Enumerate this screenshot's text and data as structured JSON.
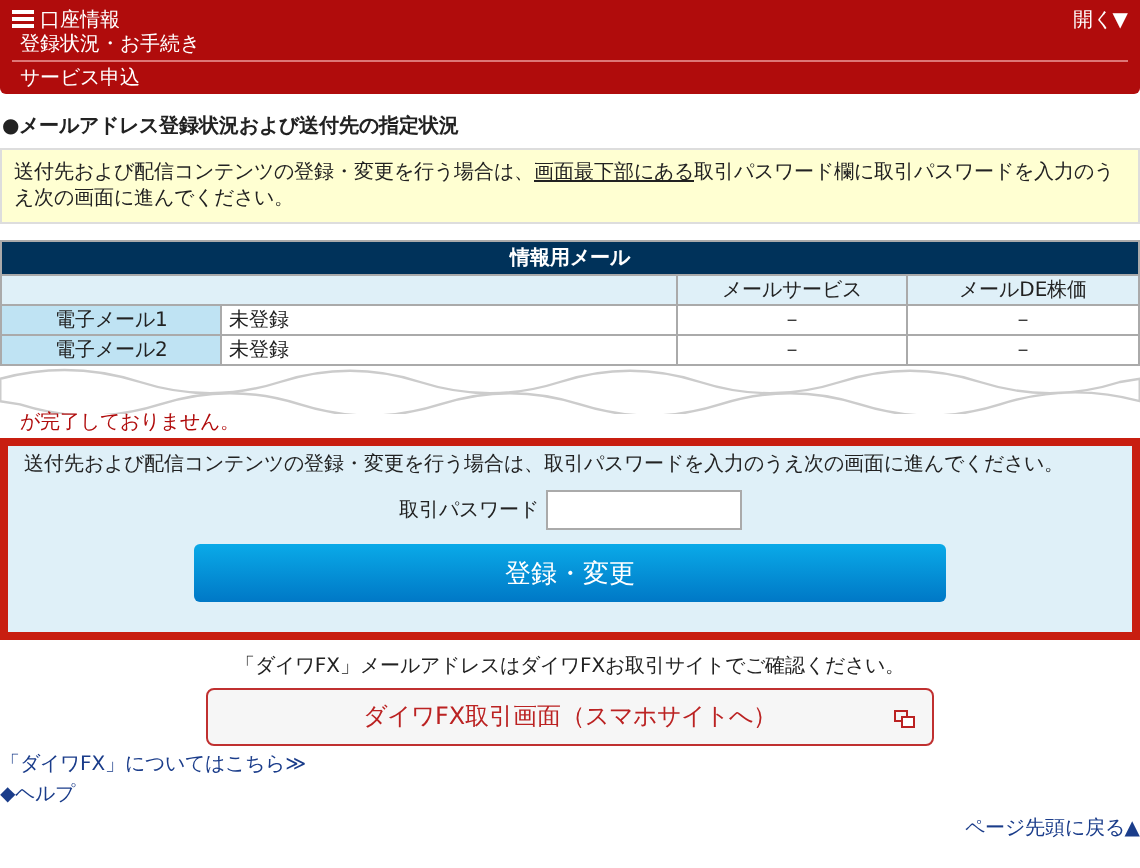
{
  "header": {
    "title": "口座情報",
    "toggle": "開く▼",
    "breadcrumb": "登録状況・お手続き",
    "subtitle": "サービス申込"
  },
  "section_title": "●メールアドレス登録状況および送付先の指定状況",
  "notice": {
    "before": "送付先および配信コンテンツの登録・変更を行う場合は、",
    "link": "画面最下部にある",
    "after": "取引パスワード欄に取引パスワードを入力のうえ次の画面に進んでください。"
  },
  "table": {
    "title": "情報用メール",
    "columns": [
      "メールサービス",
      "メールDE株価"
    ],
    "rows": [
      {
        "label": "電子メール1",
        "status": "未登録",
        "cells": [
          "－",
          "－"
        ]
      },
      {
        "label": "電子メール2",
        "status": "未登録",
        "cells": [
          "－",
          "－"
        ]
      }
    ]
  },
  "warning_tail": "が完了しておりません。",
  "form": {
    "instruction": "送付先および配信コンテンツの登録・変更を行う場合は、取引パスワードを入力のうえ次の画面に進んでください。",
    "password_label": "取引パスワード",
    "submit": "登録・変更"
  },
  "fx_note": "「ダイワFX」メールアドレスはダイワFXお取引サイトでご確認ください。",
  "fx_button": "ダイワFX取引画面（スマホサイトへ）",
  "links": [
    "「ダイワFX」についてはこちら≫",
    "◆ヘルプ"
  ],
  "page_top": "ページ先頭に戻る▲"
}
